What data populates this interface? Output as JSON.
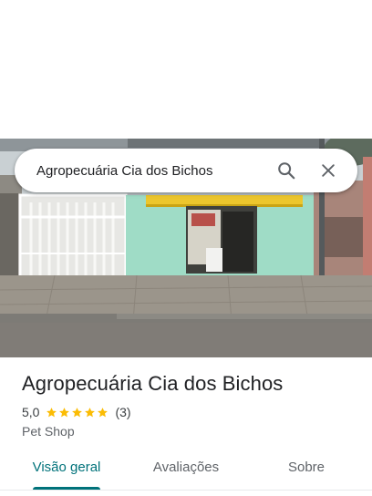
{
  "search": {
    "query": "Agropecuária Cia dos Bichos",
    "search_icon": "search-icon",
    "close_icon": "close-icon"
  },
  "place": {
    "name": "Agropecuária Cia dos Bichos",
    "rating": "5,0",
    "review_count": "(3)",
    "stars_filled": 5,
    "category": "Pet Shop"
  },
  "tabs": [
    {
      "label": "Visão geral",
      "active": true
    },
    {
      "label": "Avaliações",
      "active": false
    },
    {
      "label": "Sobre",
      "active": false
    }
  ],
  "colors": {
    "accent": "#00727a",
    "star": "#fbbc04",
    "text_primary": "#202124",
    "text_secondary": "#5f6368"
  }
}
